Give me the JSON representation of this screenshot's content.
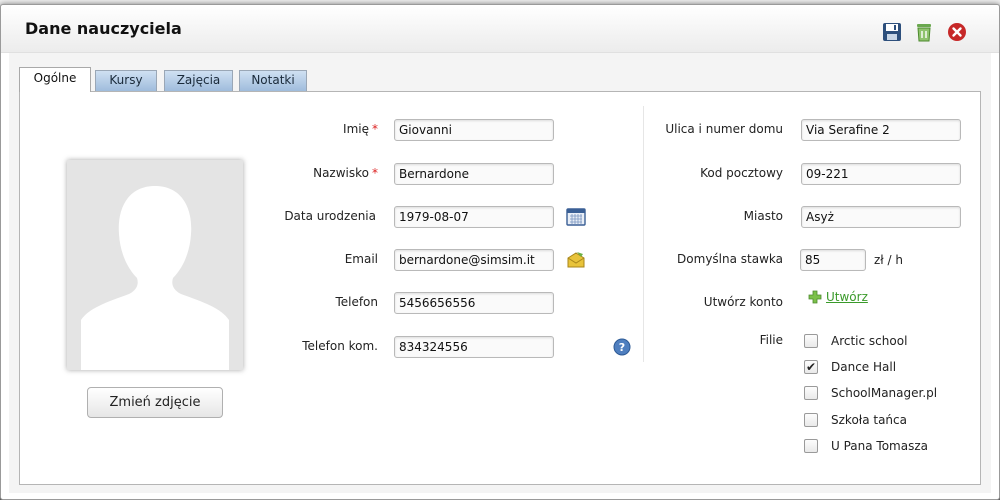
{
  "dialog": {
    "title": "Dane nauczyciela",
    "actions": {
      "save_icon": "save-icon",
      "delete_icon": "trash-icon",
      "close_icon": "close-icon"
    }
  },
  "tabs": [
    {
      "label": "Ogólne",
      "active": true
    },
    {
      "label": "Kursy",
      "active": false
    },
    {
      "label": "Zajęcia",
      "active": false
    },
    {
      "label": "Notatki",
      "active": false
    }
  ],
  "photo": {
    "change_button": "Zmień zdjęcie"
  },
  "left_form": {
    "first_name": {
      "label": "Imię",
      "required_mark": "*",
      "value": "Giovanni"
    },
    "last_name": {
      "label": "Nazwisko",
      "required_mark": "*",
      "value": "Bernardone"
    },
    "birth_date": {
      "label": "Data urodzenia",
      "value": "1979-08-07"
    },
    "email": {
      "label": "Email",
      "value": "bernardone@simsim.it"
    },
    "phone": {
      "label": "Telefon",
      "value": "5456656556"
    },
    "mobile": {
      "label": "Telefon kom.",
      "value": "834324556"
    }
  },
  "right_form": {
    "street": {
      "label": "Ulica i numer domu",
      "value": "Via Serafine 2"
    },
    "postal_code": {
      "label": "Kod pocztowy",
      "value": "09-221"
    },
    "city": {
      "label": "Miasto",
      "value": "Asyż"
    },
    "rate": {
      "label": "Domyślna stawka",
      "value": "85",
      "unit": "zł / h"
    },
    "account": {
      "label": "Utwórz konto",
      "link": "Utwórz"
    },
    "branches": {
      "label": "Filie",
      "items": [
        {
          "name": "Arctic school",
          "checked": false
        },
        {
          "name": "Dance Hall",
          "checked": true
        },
        {
          "name": "SchoolManager.pl",
          "checked": false
        },
        {
          "name": "Szkoła tańca",
          "checked": false
        },
        {
          "name": "U Pana Tomasza",
          "checked": false
        }
      ]
    }
  },
  "colors": {
    "tab_inactive": "#9fbcdc",
    "link_green": "#3a9a2a",
    "required_red": "#d22222"
  }
}
